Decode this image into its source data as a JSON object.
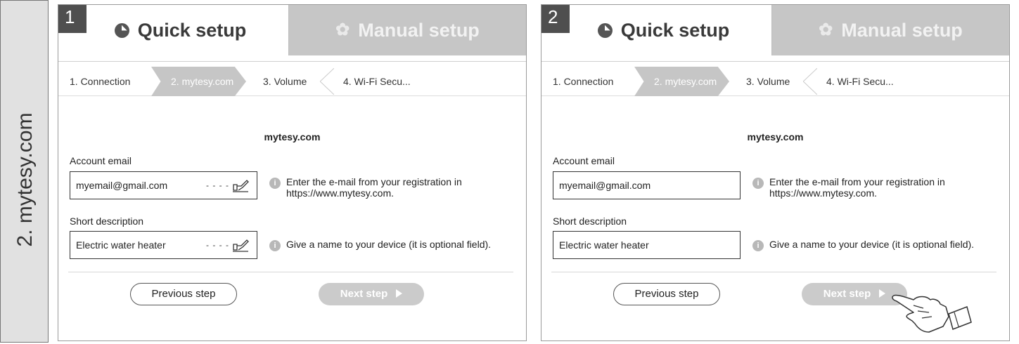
{
  "sidebar": {
    "label": "2. mytesy.com"
  },
  "panels": [
    {
      "step_number": "1",
      "tabs": {
        "quick": "Quick setup",
        "manual": "Manual setup"
      },
      "breadcrumb": [
        "1. Connection",
        "2. mytesy.com",
        "3. Volume",
        "4. Wi-Fi Secu..."
      ],
      "title": "mytesy.com",
      "email": {
        "label": "Account email",
        "value": "myemail@gmail.com",
        "hint": "Enter the e-mail from your registration in https://www.mytesy.com."
      },
      "description": {
        "label": "Short description",
        "value": "Electric water heater",
        "hint": "Give a name to your device (it is optional field)."
      },
      "buttons": {
        "previous": "Previous step",
        "next": "Next step"
      },
      "edit_marker": "- - - -"
    },
    {
      "step_number": "2",
      "tabs": {
        "quick": "Quick setup",
        "manual": "Manual setup"
      },
      "breadcrumb": [
        "1. Connection",
        "2. mytesy.com",
        "3. Volume",
        "4. Wi-Fi Secu..."
      ],
      "title": "mytesy.com",
      "email": {
        "label": "Account email",
        "value": "myemail@gmail.com",
        "hint": "Enter the e-mail from your registration in https://www.mytesy.com."
      },
      "description": {
        "label": "Short description",
        "value": "Electric water heater",
        "hint": "Give a name to your device (it is optional field)."
      },
      "buttons": {
        "previous": "Previous step",
        "next": "Next step"
      }
    }
  ],
  "icons": {
    "quick_tab": "clock-icon",
    "manual_tab": "gear-icon",
    "info": "info-icon",
    "edit": "pen-icon",
    "pointer": "hand-pointer-icon"
  },
  "colors": {
    "sidebar_bg": "#e1e1e1",
    "manual_tab_bg": "#c6c6c6",
    "active_crumb_bg": "#c6c6c6",
    "next_button_bg": "#cbcbcb",
    "step_badge_bg": "#4f4f4f"
  }
}
